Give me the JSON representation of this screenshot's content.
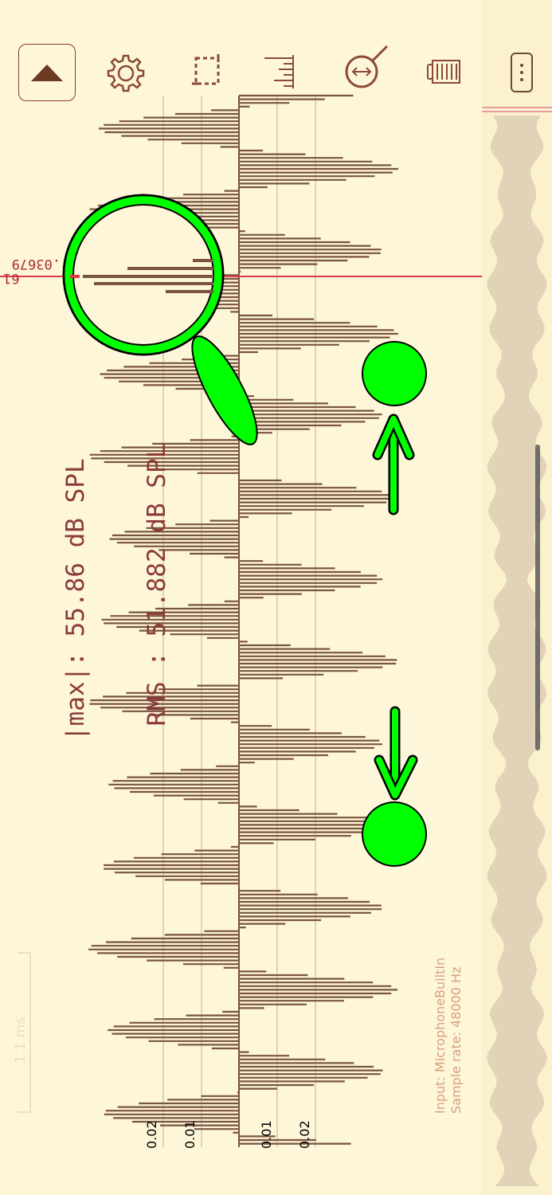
{
  "toolbar": {
    "collapse_icon": "triangle-up-icon",
    "settings_icon": "gear-icon",
    "crop_icon": "crop-select-icon",
    "ruler_icon": "ruler-icon",
    "zoom_icon": "zoom-fit-icon",
    "trash_icon": "trash-icon",
    "menu_icon": "more-vertical-icon"
  },
  "stats": {
    "max_line": "|max|: 55.86 dB SPL",
    "rms_line": " RMS : 51.882 dB SPL"
  },
  "cursor": {
    "readout_line1": ".03679",
    "readout_line2": "61"
  },
  "axis": {
    "ticks": [
      "0.02",
      "0.01",
      "0.01",
      "0.02"
    ]
  },
  "scale_bar": {
    "label": "1.1 ms"
  },
  "input": {
    "source": "Input: MicrophoneBuiltIn",
    "sample_rate": "Sample rate: 48000 Hz"
  },
  "colors": {
    "background": "#fdf6d8",
    "waveform": "#7a5440",
    "cursor": "#e03a4a",
    "overlay": "#00ff00",
    "overview": "#e0d3b8"
  }
}
